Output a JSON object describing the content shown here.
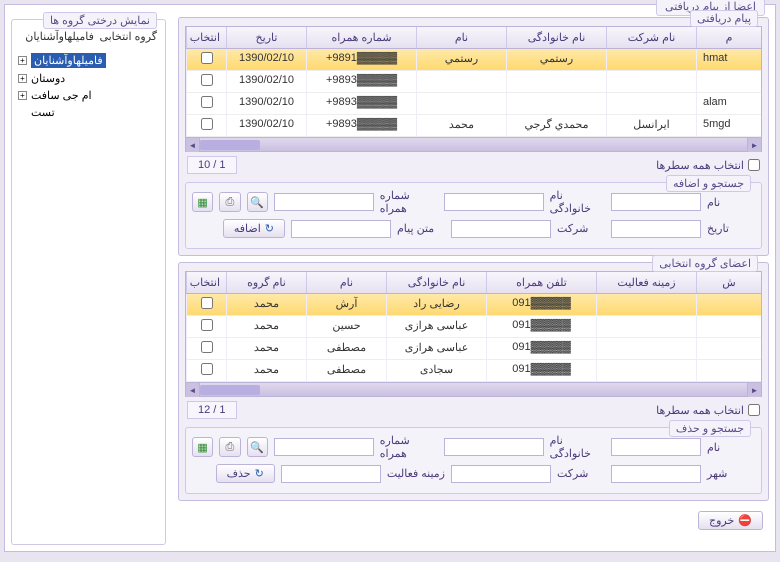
{
  "window": {
    "title": "اعضا از پیام دریافتی"
  },
  "sidebar": {
    "title": "نمایش درختی گروه ها",
    "selected_label": "گروه انتخابی",
    "selected_value": "فامیلهاوآشنایان",
    "items": [
      {
        "label": "فامیلهاوآشنایان",
        "expandable": true,
        "selected": true
      },
      {
        "label": "دوستان",
        "expandable": true,
        "selected": false
      },
      {
        "label": "ام جی سافت",
        "expandable": true,
        "selected": false
      },
      {
        "label": "تست",
        "expandable": false,
        "selected": false
      }
    ]
  },
  "panel1": {
    "title": "پیام دریافتی",
    "headers": {
      "sel": "انتخاب",
      "date": "تاریخ",
      "mobile": "شماره همراه",
      "name": "نام",
      "lastname": "نام خانوادگی",
      "company": "نام شرکت",
      "m": "م"
    },
    "rows": [
      {
        "date": "1390/02/10",
        "mobile": "+9891▓▓▓▓▓",
        "name": "رستمي",
        "lastname": "رستمي",
        "company": "",
        "m": "hmat",
        "sel": true
      },
      {
        "date": "1390/02/10",
        "mobile": "+9893▓▓▓▓▓",
        "name": "",
        "lastname": "",
        "company": "",
        "m": ""
      },
      {
        "date": "1390/02/10",
        "mobile": "+9893▓▓▓▓▓",
        "name": "",
        "lastname": "",
        "company": "",
        "m": "alam"
      },
      {
        "date": "1390/02/10",
        "mobile": "+9893▓▓▓▓▓",
        "name": "محمد",
        "lastname": "محمدي گرجي",
        "company": "ايرانسل",
        "m": "5mgd"
      }
    ],
    "pager": "1 / 10",
    "select_all": "انتخاب همه سطرها"
  },
  "search1": {
    "title": "جستجو و اضافه",
    "labels": {
      "name": "نام",
      "lastname": "نام خانوادگی",
      "mobile": "شماره همراه",
      "date": "تاریخ",
      "company": "شرکت",
      "message": "متن پیام"
    },
    "add_btn": "اضافه"
  },
  "panel2": {
    "title": "اعضای گروه انتخابی",
    "headers": {
      "sel": "انتخاب",
      "group": "نام گروه",
      "name": "نام",
      "lastname": "نام خانوادگی",
      "mobile": "تلفن همراه",
      "activity": "زمینه فعالیت",
      "sh": "ش"
    },
    "rows": [
      {
        "group": "محمد",
        "name": "آرش",
        "lastname": "رضایی راد",
        "mobile": "091▓▓▓▓▓",
        "sel": true
      },
      {
        "group": "محمد",
        "name": "حسین",
        "lastname": "عباسی هرازی",
        "mobile": "091▓▓▓▓▓"
      },
      {
        "group": "محمد",
        "name": "مصطفی",
        "lastname": "عباسی هرازی",
        "mobile": "091▓▓▓▓▓"
      },
      {
        "group": "محمد",
        "name": "مصطفی",
        "lastname": "سجادی",
        "mobile": "091▓▓▓▓▓"
      }
    ],
    "pager": "1 / 12",
    "select_all": "انتخاب همه سطرها"
  },
  "search2": {
    "title": "جستجو و حذف",
    "labels": {
      "name": "نام",
      "lastname": "نام خانوادگی",
      "mobile": "شماره همراه",
      "city": "شهر",
      "company": "شرکت",
      "activity": "زمینه فعالیت"
    },
    "del_btn": "حذف"
  },
  "exit_btn": "خروج",
  "icons": {
    "refresh": "↻",
    "excel": "▦",
    "print": "⎙",
    "search": "🔍",
    "add": "↻",
    "del": "↻",
    "exit": "⛔"
  }
}
